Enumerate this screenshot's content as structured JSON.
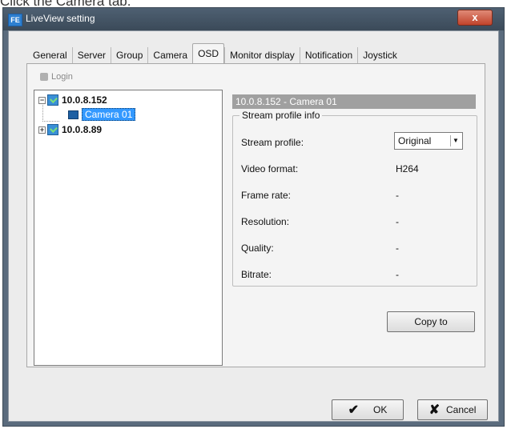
{
  "caption": "Click the Camera tab.",
  "window": {
    "title": "LiveView setting",
    "close_glyph": "x",
    "app_icon_text": "FE"
  },
  "tabs": [
    "General",
    "Server",
    "Group",
    "Camera",
    "OSD",
    "Monitor display",
    "Notification",
    "Joystick"
  ],
  "active_tab": "Camera",
  "login_label": "Login",
  "tree": {
    "server1": "10.0.8.152",
    "camera": "Camera 01",
    "server2": "10.0.8.89",
    "expander_minus": "−",
    "expander_plus": "+"
  },
  "detail": {
    "header": "10.0.8.152 - Camera 01",
    "group_title": "Stream profile info",
    "stream_profile_label": "Stream profile:",
    "stream_profile_value": "Original",
    "video_format_label": "Video format:",
    "video_format_value": "H264",
    "frame_rate_label": "Frame rate:",
    "frame_rate_value": "-",
    "resolution_label": "Resolution:",
    "resolution_value": "-",
    "quality_label": "Quality:",
    "quality_value": "-",
    "bitrate_label": "Bitrate:",
    "bitrate_value": "-"
  },
  "buttons": {
    "copy": "Copy to",
    "ok": "OK",
    "cancel": "Cancel"
  },
  "colors": {
    "selection": "#3399ff",
    "header_bar": "#a0a0a0",
    "close": "#c0432b"
  },
  "icons": {
    "ok": "check-icon",
    "cancel": "x-icon",
    "dropdown": "chevron-down-icon"
  }
}
